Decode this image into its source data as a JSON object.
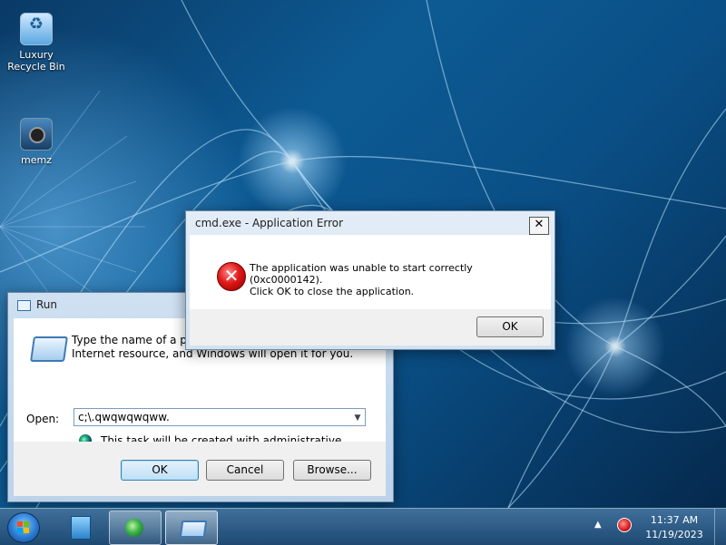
{
  "desktop": {
    "icons": [
      {
        "label": "Luxury Recycle Bin",
        "icon": "recycle-bin-icon"
      },
      {
        "label": "memz",
        "icon": "memz-icon"
      }
    ]
  },
  "run_dialog": {
    "title": "Run",
    "description": "Type the name of a program, folder, document, or Internet resource, and Windows will open it for you.",
    "open_label": "Open:",
    "open_value": "c;\\.qwqwqwqww.",
    "admin_note": "This task will be created with administrative privileges.",
    "ok_label": "OK",
    "cancel_label": "Cancel",
    "browse_label": "Browse..."
  },
  "error_dialog": {
    "title": "cmd.exe - Application Error",
    "close_glyph": "✕",
    "message_line1": "The application was unable to start correctly (0xc0000142).",
    "message_line2": "Click OK to close the application.",
    "ok_label": "OK",
    "icon_glyph": "✕"
  },
  "taskbar": {
    "pinned": [
      "windows-explorer-icon",
      "memz-app-icon",
      "run-dialog-icon"
    ],
    "tray_arrow": "▲",
    "time": "11:37 AM",
    "date": "11/19/2023"
  },
  "colors": {
    "accent": "#3c7fb1",
    "error": "#e01818",
    "taskbar": "#1e4a72"
  }
}
